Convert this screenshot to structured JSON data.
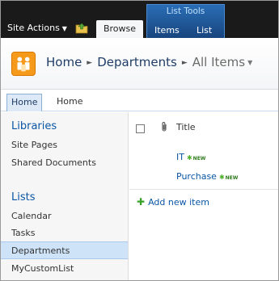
{
  "ribbon": {
    "site_actions_label": "Site Actions",
    "browse_tab_label": "Browse",
    "list_tools_label": "List Tools",
    "items_tab_label": "Items",
    "list_tab_label": "List"
  },
  "breadcrumb": {
    "home": "Home",
    "section": "Departments",
    "current": "All Items"
  },
  "topnav": {
    "items": [
      {
        "label": "Home",
        "selected": true
      },
      {
        "label": "Home",
        "selected": false
      }
    ]
  },
  "quicklaunch": {
    "libraries_heading": "Libraries",
    "libraries": [
      "Site Pages",
      "Shared Documents"
    ],
    "lists_heading": "Lists",
    "lists": [
      "Calendar",
      "Tasks",
      "Departments",
      "MyCustomList"
    ],
    "selected": "Departments"
  },
  "list": {
    "title_header": "Title",
    "rows": [
      {
        "title": "IT",
        "badge": "NEW"
      },
      {
        "title": "Purchase",
        "badge": "NEW"
      }
    ],
    "add_new_label": "Add new item"
  },
  "colors": {
    "ribbon_bg": "#1a1a1a",
    "contextual_tab": "#2a6db5",
    "link_blue": "#0a56a5",
    "selected_nav_bg": "#cfe3f8",
    "new_badge_green": "#2c7a1c"
  }
}
